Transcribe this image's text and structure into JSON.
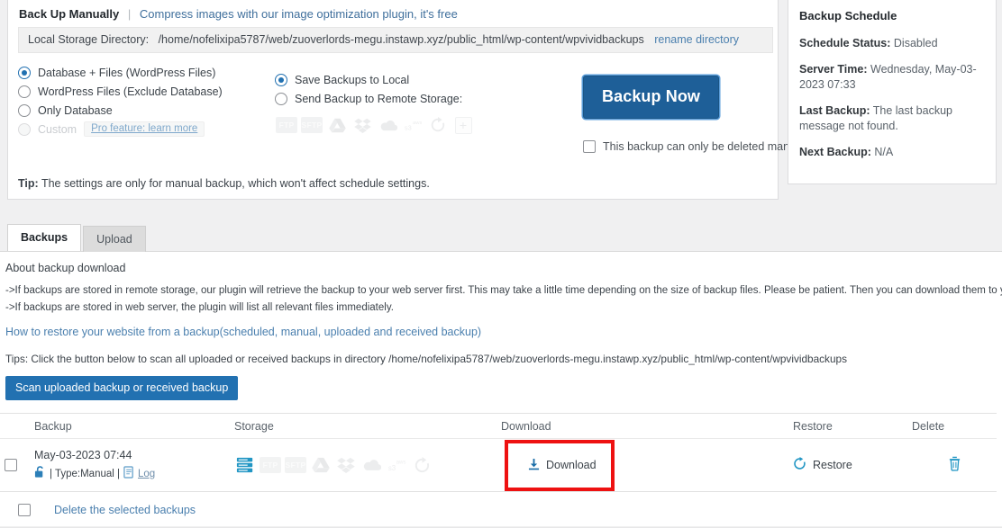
{
  "manual": {
    "title": "Back Up Manually",
    "separator": "|",
    "promo_link": "Compress images with our image optimization plugin, it's free",
    "directory": {
      "label": "Local Storage Directory:",
      "path": "/home/nofelixipa5787/web/zuoverlords-megu.instawp.xyz/public_html/wp-content/wpvividbackups",
      "rename_link": "rename directory"
    },
    "backup_type_options": [
      {
        "label": "Database + Files (WordPress Files)",
        "checked": true,
        "disabled": false
      },
      {
        "label": "WordPress Files (Exclude Database)",
        "checked": false,
        "disabled": false
      },
      {
        "label": "Only Database",
        "checked": false,
        "disabled": false
      },
      {
        "label": "Custom",
        "checked": false,
        "disabled": true
      }
    ],
    "pro_pill": "Pro feature: learn more",
    "destination_options": [
      {
        "label": "Save Backups to Local",
        "checked": true
      },
      {
        "label": "Send Backup to Remote Storage:",
        "checked": false
      }
    ],
    "remote_providers": [
      {
        "name": "ftp-icon",
        "label": "FTP"
      },
      {
        "name": "sftp-icon",
        "label": "SFTP"
      },
      {
        "name": "google-drive-icon",
        "label": ""
      },
      {
        "name": "dropbox-icon",
        "label": ""
      },
      {
        "name": "onedrive-icon",
        "label": ""
      },
      {
        "name": "amazon-s3-icon",
        "label": ""
      },
      {
        "name": "refresh-icon",
        "label": ""
      },
      {
        "name": "add-storage-icon",
        "label": "+"
      }
    ],
    "backup_now_label": "Backup Now",
    "delete_manually_label": "This backup can only be deleted manually",
    "delete_manually_checked": false,
    "tip_prefix": "Tip:",
    "tip_text": "The settings are only for manual backup, which won't affect schedule settings."
  },
  "schedule": {
    "title": "Backup Schedule",
    "items": [
      {
        "label": "Schedule Status:",
        "value": "Disabled"
      },
      {
        "label": "Server Time:",
        "value": "Wednesday, May-03-2023 07:33"
      },
      {
        "label": "Last Backup:",
        "value": "The last backup message not found."
      },
      {
        "label": "Next Backup:",
        "value": "N/A"
      }
    ]
  },
  "tabs": [
    {
      "label": "Backups",
      "active": true
    },
    {
      "label": "Upload",
      "active": false
    }
  ],
  "about": {
    "title": "About backup download",
    "lines": [
      "->If backups are stored in remote storage, our plugin will retrieve the backup to your web server first. This may take a little time depending on the size of backup files. Please be patient. Then you can download them to your PC.",
      "->If backups are stored in web server, the plugin will list all relevant files immediately."
    ],
    "restore_link": "How to restore your website from a backup(scheduled, manual, uploaded and received backup)",
    "tips_line": "Tips: Click the button below to scan all uploaded or received backups in directory /home/nofelixipa5787/web/zuoverlords-megu.instawp.xyz/public_html/wp-content/wpvividbackups",
    "scan_button": "Scan uploaded backup or received backup"
  },
  "table": {
    "headers": {
      "backup": "Backup",
      "storage": "Storage",
      "download": "Download",
      "restore": "Restore",
      "delete": "Delete"
    },
    "row": {
      "date": "May-03-2023 07:44",
      "type_text": "| Type:Manual |",
      "log_label": "Log",
      "download_label": "Download",
      "restore_label": "Restore",
      "checked": false,
      "storage_icons": [
        {
          "name": "web-server-icon",
          "active": true,
          "label": ""
        },
        {
          "name": "ftp-icon",
          "active": false,
          "label": "FTP"
        },
        {
          "name": "sftp-icon",
          "active": false,
          "label": "SFTP"
        },
        {
          "name": "google-drive-icon",
          "active": false,
          "label": ""
        },
        {
          "name": "dropbox-icon",
          "active": false,
          "label": ""
        },
        {
          "name": "onedrive-icon",
          "active": false,
          "label": ""
        },
        {
          "name": "amazon-s3-icon",
          "active": false,
          "label": ""
        },
        {
          "name": "refresh-icon",
          "active": false,
          "label": ""
        }
      ]
    },
    "footer": {
      "delete_selected_label": "Delete the selected backups",
      "checked": false
    }
  },
  "colors": {
    "accent_blue": "#2271b1",
    "button_blue": "#1e5f98",
    "link_blue": "#4a7fae",
    "highlight_red": "#ee1111",
    "icon_cyan": "#2196c4"
  }
}
